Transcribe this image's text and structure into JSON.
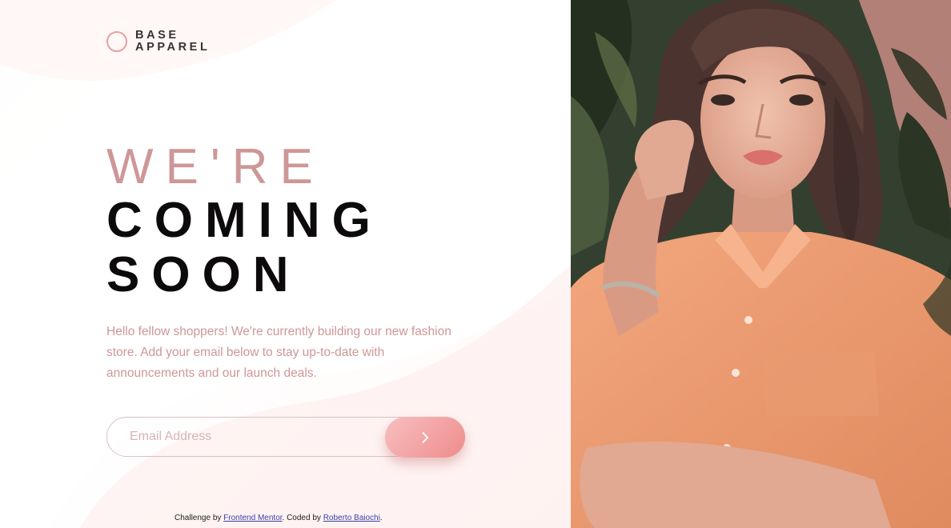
{
  "brand": {
    "line1": "BASE",
    "line2": "APPAREL",
    "accent_color": "#e8a09e"
  },
  "hero": {
    "line1": "WE'RE",
    "line2": "COMING",
    "line3": "SOON",
    "intro": "Hello fellow shoppers! We're currently building our new fashion store. Add your email below to stay up-to-date with announcements and our launch deals."
  },
  "form": {
    "email_placeholder": "Email Address",
    "submit_icon": "chevron-right-icon"
  },
  "footer": {
    "prefix": "Challenge by ",
    "link1": "Frontend Mentor",
    "middle": ". Coded by ",
    "link2": "Roberto Baiochi",
    "suffix": "."
  },
  "colors": {
    "desaturated_red": "#ce9797",
    "dark_text": "#0c0a0b",
    "button_gradient_start": "#f8bfbf",
    "button_gradient_end": "#ee8c8c"
  }
}
